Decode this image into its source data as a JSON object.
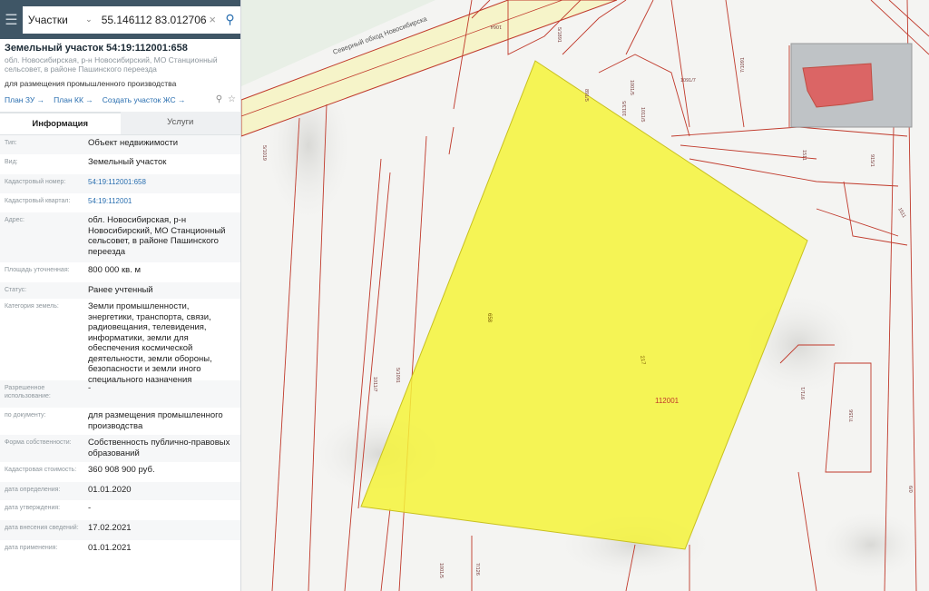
{
  "search": {
    "category": "Участки",
    "query": "55.146112 83.012706"
  },
  "parcel": {
    "title": "Земельный участок 54:19:112001:658",
    "address_short": "обл. Новосибирская, р-н Новосибирский, МО Станционный сельсовет, в районе Пашинского переезда",
    "purpose": "для размещения промышленного производства",
    "links": [
      "План ЗУ →",
      "План КК →",
      "Создать участок ЖС →"
    ]
  },
  "tabs": [
    "Информация",
    "Услуги"
  ],
  "info": [
    {
      "key": "Тип:",
      "value": "Объект недвижимости"
    },
    {
      "key": "Вид:",
      "value": "Земельный участок"
    },
    {
      "key": "Кадастровый номер:",
      "value": "54:19:112001:658"
    },
    {
      "key": "Кадастровый квартал:",
      "value": "54:19:112001"
    },
    {
      "key": "Адрес:",
      "value": "обл. Новосибирская, р-н Новосибирский, МО Станционный сельсовет, в районе Пашинского переезда"
    },
    {
      "key": "Площадь уточненная:",
      "value": "800 000 кв. м"
    },
    {
      "key": "Статус:",
      "value": "Ранее учтенный"
    },
    {
      "key": "Категория земель:",
      "value": "Земли промышленности, энергетики, транспорта, связи, радиовещания, телевидения, информатики, земли для обеспечения космической деятельности, земли обороны, безопасности и земли иного специального назначения"
    },
    {
      "key": "Разрешенное использование:",
      "value": "-"
    },
    {
      "key": "по документу:",
      "value": "для размещения промышленного производства"
    },
    {
      "key": "Форма собственности:",
      "value": "Собственность публично-правовых образований"
    },
    {
      "key": "Кадастровая стоимость:",
      "value": "360 908 900 руб."
    },
    {
      "key": "дата определения:",
      "value": "01.01.2020"
    },
    {
      "key": "дата утверждения:",
      "value": "-"
    },
    {
      "key": "дата внесения сведений:",
      "value": "17.02.2021"
    },
    {
      "key": "дата применения:",
      "value": "01.01.2021"
    }
  ],
  "map": {
    "road_label": "Северный обход Новосибирска",
    "parcel_label_1": "658",
    "parcel_label_2": "217",
    "quarter_label": "112001",
    "labels": [
      "1064",
      "5/1891",
      "1001/5",
      "891/5",
      "1013/5",
      "1011/5",
      "7/1091",
      "5/1019",
      "1091/7",
      "1511",
      "915/1",
      "1511",
      "7/156",
      "1011/7",
      "971/1",
      "5/1091",
      "7/126",
      "1001/5",
      "6/0"
    ],
    "colors": {
      "parcel_fill": "#f5f33a",
      "boundary": "#c0392b",
      "road": "#f6f4c9",
      "grey_area": "#bfc3c6",
      "red_area": "#e05555"
    }
  }
}
